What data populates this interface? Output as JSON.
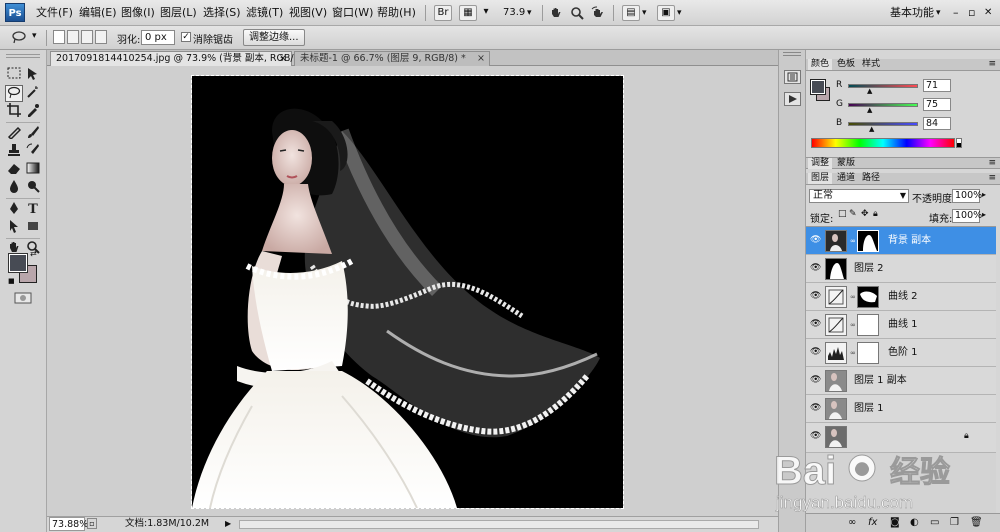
{
  "app": {
    "logo": "Ps",
    "workspace": "基本功能",
    "zoom_value": "73.9"
  },
  "menus": [
    "文件(F)",
    "编辑(E)",
    "图像(I)",
    "图层(L)",
    "选择(S)",
    "滤镜(T)",
    "视图(V)",
    "窗口(W)",
    "帮助(H)"
  ],
  "window_controls": {
    "minimize": "–",
    "restore": "▫",
    "close": "✕"
  },
  "options": {
    "feather_label": "羽化:",
    "feather_value": "0 px",
    "antialias_label": "消除锯齿",
    "refine_edge_label": "调整边缘..."
  },
  "tabs": [
    {
      "label": "2017091814410254.jpg @ 73.9% (背景 副本, RGB/8#) *",
      "close": "×"
    },
    {
      "label": "未标题-1 @ 66.7% (图层 9, RGB/8) *",
      "close": "×"
    }
  ],
  "status": {
    "zoom": "73.88%",
    "doc": "文档:1.83M/10.2M"
  },
  "color_panel": {
    "tabs": [
      "颜色",
      "色板",
      "样式"
    ],
    "r_label": "R",
    "r": "71",
    "g_label": "G",
    "g": "75",
    "b_label": "B",
    "b": "84",
    "fg_color": "#474b54",
    "bg_color": "#b9a6ab"
  },
  "adjust_tabs": [
    "调整",
    "蒙版"
  ],
  "layers_panel": {
    "tabs": [
      "图层",
      "通道",
      "路径"
    ],
    "blend_mode": "正常",
    "opacity_label": "不透明度:",
    "opacity": "100%",
    "lock_label": "锁定:",
    "fill_label": "填充:",
    "fill": "100%",
    "layers": [
      {
        "name": "背景 副本",
        "selected": true
      },
      {
        "name": "图层 2",
        "selected": false
      },
      {
        "name": "曲线 2",
        "selected": false
      },
      {
        "name": "曲线 1",
        "selected": false
      },
      {
        "name": "色阶 1",
        "selected": false
      },
      {
        "name": "图层 1 副本",
        "selected": false
      },
      {
        "name": "图层 1",
        "selected": false
      },
      {
        "name": "",
        "selected": false
      }
    ],
    "footer_icons": [
      "link-icon",
      "fx-icon",
      "mask-icon",
      "adjustment-icon",
      "group-icon",
      "new-layer-icon",
      "trash-icon"
    ]
  },
  "watermark": {
    "line1": "Bai",
    "line2": "经验",
    "line3": "jingyan.baidu.com"
  },
  "accent_color": "#3e8fe5"
}
